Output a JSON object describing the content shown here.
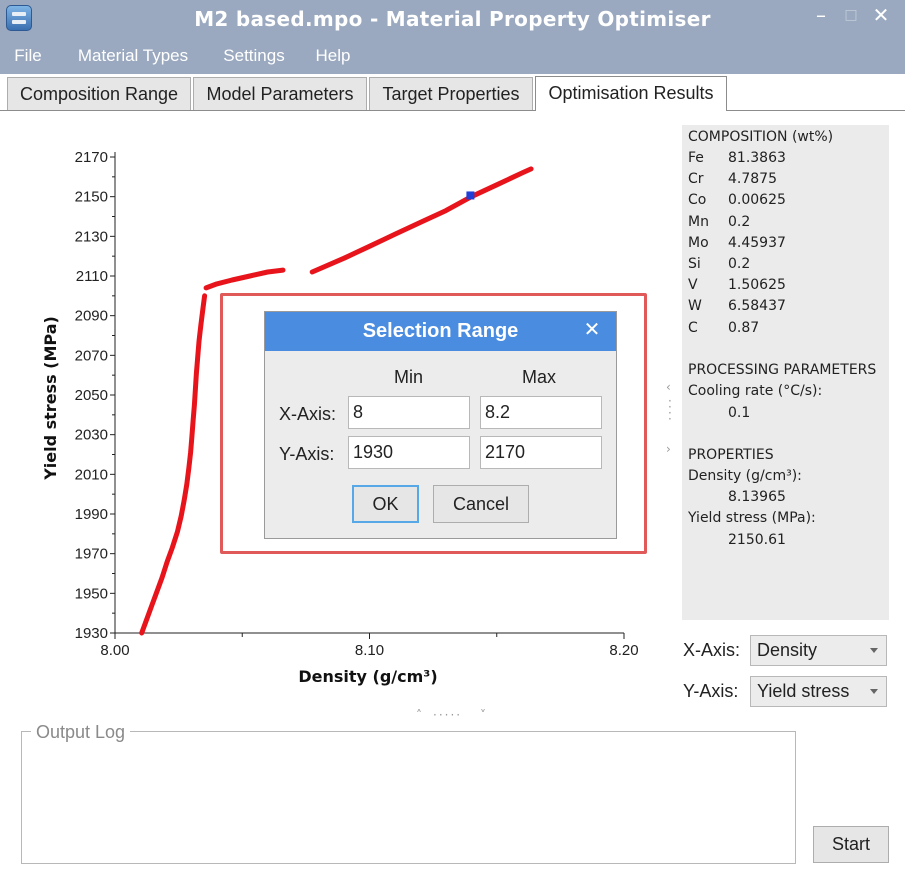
{
  "window": {
    "title": "M2 based.mpo - Material Property Optimiser",
    "minimize": "–",
    "maximize": "□",
    "close": "✕"
  },
  "menu": [
    "File",
    "Material Types",
    "Settings",
    "Help"
  ],
  "tabs": [
    "Composition Range",
    "Model Parameters",
    "Target Properties",
    "Optimisation Results"
  ],
  "active_tab": "Optimisation Results",
  "chart_data": {
    "type": "scatter",
    "xlabel": "Density (g/cm³)",
    "ylabel": "Yield stress (MPa)",
    "xlim": [
      8.0,
      8.2
    ],
    "ylim": [
      1930,
      2170
    ],
    "x_ticks": [
      "8.00",
      "8.10",
      "8.20"
    ],
    "y_ticks": [
      "1930",
      "1950",
      "1970",
      "1990",
      "2010",
      "2030",
      "2050",
      "2070",
      "2090",
      "2110",
      "2130",
      "2150",
      "2170"
    ],
    "series": [
      {
        "color": "#e8141c",
        "segments": [
          [
            [
              8.0105,
              1930
            ],
            [
              8.0125,
              1937
            ],
            [
              8.0145,
              1944
            ],
            [
              8.0165,
              1951
            ],
            [
              8.0185,
              1958
            ],
            [
              8.0205,
              1966
            ],
            [
              8.0225,
              1973
            ],
            [
              8.0245,
              1981
            ],
            [
              8.026,
              1989
            ],
            [
              8.0272,
              1997
            ],
            [
              8.0282,
              2005
            ],
            [
              8.029,
              2013
            ],
            [
              8.0297,
              2021
            ],
            [
              8.0302,
              2029
            ],
            [
              8.0307,
              2037
            ],
            [
              8.0312,
              2045
            ],
            [
              8.0316,
              2053
            ],
            [
              8.032,
              2061
            ],
            [
              8.0325,
              2069
            ],
            [
              8.033,
              2077
            ],
            [
              8.0337,
              2085
            ],
            [
              8.0345,
              2093
            ],
            [
              8.0352,
              2100
            ]
          ],
          [
            [
              8.0358,
              2104
            ],
            [
              8.04,
              2106
            ],
            [
              8.046,
              2108
            ],
            [
              8.053,
              2110
            ],
            [
              8.06,
              2112
            ],
            [
              8.066,
              2113
            ]
          ],
          [
            [
              8.0775,
              2112
            ],
            [
              8.09,
              2119
            ],
            [
              8.1,
              2125
            ],
            [
              8.11,
              2131
            ],
            [
              8.12,
              2137
            ],
            [
              8.13,
              2143
            ],
            [
              8.14,
              2150
            ],
            [
              8.15,
              2156
            ],
            [
              8.16,
              2162
            ],
            [
              8.1635,
              2164
            ]
          ]
        ]
      }
    ],
    "selected_point": {
      "x": 8.13965,
      "y": 2150.61,
      "color": "#1f3fd6"
    }
  },
  "info_panel": {
    "composition_title": "COMPOSITION (wt%)",
    "composition": [
      {
        "el": "Fe",
        "val": "81.3863"
      },
      {
        "el": "Cr",
        "val": "4.7875"
      },
      {
        "el": "Co",
        "val": "0.00625"
      },
      {
        "el": "Mn",
        "val": "0.2"
      },
      {
        "el": "Mo",
        "val": "4.45937"
      },
      {
        "el": "Si",
        "val": "0.2"
      },
      {
        "el": "V",
        "val": "1.50625"
      },
      {
        "el": "W",
        "val": "6.58437"
      },
      {
        "el": "C",
        "val": "0.87"
      }
    ],
    "processing_title": "PROCESSING PARAMETERS",
    "cooling_label": "Cooling rate (°C/s):",
    "cooling_value": "0.1",
    "properties_title": "PROPERTIES",
    "density_label": "Density (g/cm³):",
    "density_value": "8.13965",
    "yield_label": "Yield stress (MPa):",
    "yield_value": "2150.61"
  },
  "axis_select": {
    "x_label": "X-Axis:",
    "x_value": "Density",
    "y_label": "Y-Axis:",
    "y_value": "Yield stress"
  },
  "output_log": {
    "label": "Output Log"
  },
  "start_label": "Start",
  "dialog": {
    "title": "Selection Range",
    "close": "✕",
    "min_header": "Min",
    "max_header": "Max",
    "x_label": "X-Axis:",
    "y_label": "Y-Axis:",
    "x_min": "8",
    "x_max": "8.2",
    "y_min": "1930",
    "y_max": "2170",
    "ok_label": "OK",
    "cancel_label": "Cancel"
  }
}
